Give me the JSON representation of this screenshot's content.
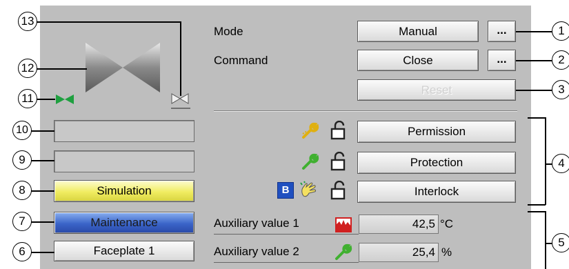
{
  "callouts": [
    "1",
    "2",
    "3",
    "4",
    "5",
    "6",
    "7",
    "8",
    "9",
    "10",
    "11",
    "12",
    "13"
  ],
  "mode": {
    "label": "Mode",
    "value": "Manual",
    "more": "..."
  },
  "command": {
    "label": "Command",
    "value": "Close",
    "more": "..."
  },
  "reset": {
    "label": "Reset"
  },
  "locks": {
    "permission": "Permission",
    "protection": "Protection",
    "interlock": "Interlock",
    "bypass_badge": "B"
  },
  "status_buttons": {
    "simulation": "Simulation",
    "maintenance": "Maintenance",
    "faceplate": "Faceplate 1"
  },
  "aux": [
    {
      "label": "Auxiliary value 1",
      "value": "42,5",
      "unit": "°C"
    },
    {
      "label": "Auxiliary value 2",
      "value": "25,4",
      "unit": "%"
    }
  ],
  "colors": {
    "panel": "#bebebe",
    "simulation": "#f4f07a",
    "maintenance": "#3a64c8",
    "valve_open_green": "#1fa040",
    "wrench_yellow": "#f0c020",
    "wrench_green": "#40b030",
    "bypass_blue": "#2050c0",
    "temp_red": "#d02020"
  },
  "icons": [
    "valve-icon",
    "valve-small-green-icon",
    "valve-small-gray-icon",
    "wrench-yellow-icon",
    "wrench-green-icon",
    "padlock-icon",
    "hand-icon",
    "thermometer-icon"
  ]
}
